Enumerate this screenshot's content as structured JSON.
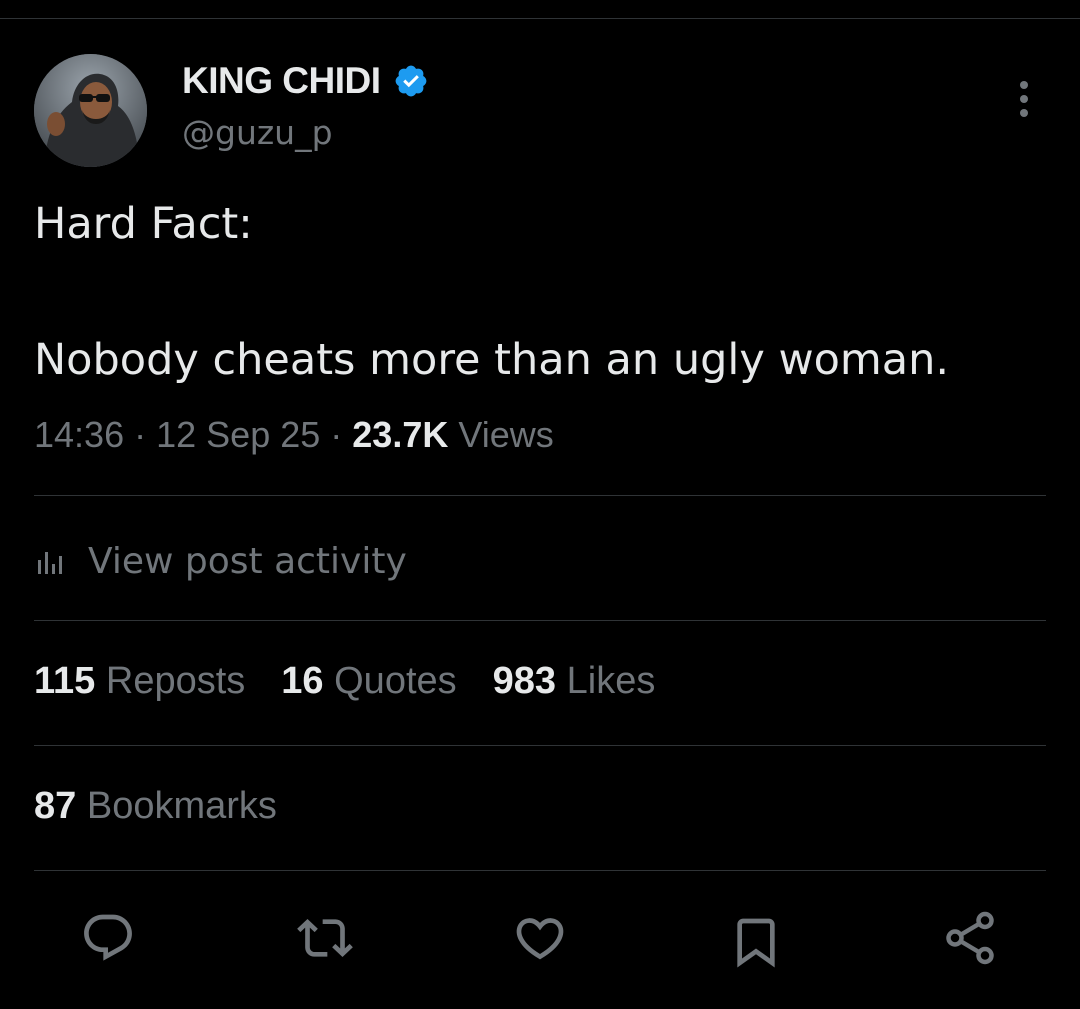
{
  "author": {
    "display_name": "KING CHIDI",
    "handle": "@guzu_p",
    "verified": true
  },
  "tweet": {
    "lines": [
      "Hard Fact:",
      "Nobody cheats more than an ugly woman."
    ]
  },
  "meta": {
    "time": "14:36",
    "date": "12 Sep 25",
    "views_count": "23.7K",
    "views_label": "Views"
  },
  "activity": {
    "label": "View post activity"
  },
  "stats": {
    "reposts": {
      "count": "115",
      "label": "Reposts"
    },
    "quotes": {
      "count": "16",
      "label": "Quotes"
    },
    "likes": {
      "count": "983",
      "label": "Likes"
    },
    "bookmarks": {
      "count": "87",
      "label": "Bookmarks"
    }
  },
  "actions": [
    {
      "icon": "reply-icon"
    },
    {
      "icon": "repost-icon"
    },
    {
      "icon": "like-icon"
    },
    {
      "icon": "bookmark-icon"
    },
    {
      "icon": "share-icon"
    }
  ],
  "colors": {
    "background": "#000000",
    "text_primary": "#e7e9ea",
    "text_secondary": "#71767b",
    "divider": "#2f3336",
    "verified_badge": "#1d9bf0"
  }
}
